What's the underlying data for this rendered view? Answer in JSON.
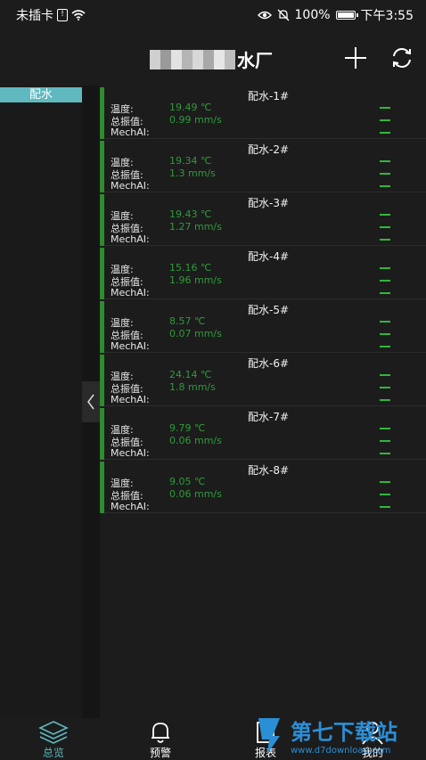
{
  "status": {
    "carrier": "未插卡",
    "battery": "100%",
    "time": "下午3:55"
  },
  "header": {
    "title": "水厂"
  },
  "sidebar": {
    "items": [
      {
        "label": "配水"
      }
    ]
  },
  "labels": {
    "temp": "温度:",
    "vib": "总振值:",
    "mech": "MechAI:"
  },
  "devices": [
    {
      "name": "配水-1#",
      "temp": "19.49 ℃",
      "vib": "0.99 mm/s"
    },
    {
      "name": "配水-2#",
      "temp": "19.34 ℃",
      "vib": "1.3 mm/s"
    },
    {
      "name": "配水-3#",
      "temp": "19.43 ℃",
      "vib": "1.27 mm/s"
    },
    {
      "name": "配水-4#",
      "temp": "15.16 ℃",
      "vib": "1.96 mm/s"
    },
    {
      "name": "配水-5#",
      "temp": "8.57 ℃",
      "vib": "0.07 mm/s"
    },
    {
      "name": "配水-6#",
      "temp": "24.14 ℃",
      "vib": "1.8 mm/s"
    },
    {
      "name": "配水-7#",
      "temp": "9.79 ℃",
      "vib": "0.06 mm/s"
    },
    {
      "name": "配水-8#",
      "temp": "9.05 ℃",
      "vib": "0.06 mm/s"
    }
  ],
  "tabs": [
    {
      "label": "总览",
      "active": true
    },
    {
      "label": "预警"
    },
    {
      "label": "报表"
    },
    {
      "label": "我的"
    }
  ],
  "watermark": {
    "text": "第七下载站",
    "url": "www.d7download.com"
  },
  "colors": {
    "accent": "#5fb9bf",
    "status_green": "#2f9a3a",
    "card_bar": "#2e8b2e"
  }
}
